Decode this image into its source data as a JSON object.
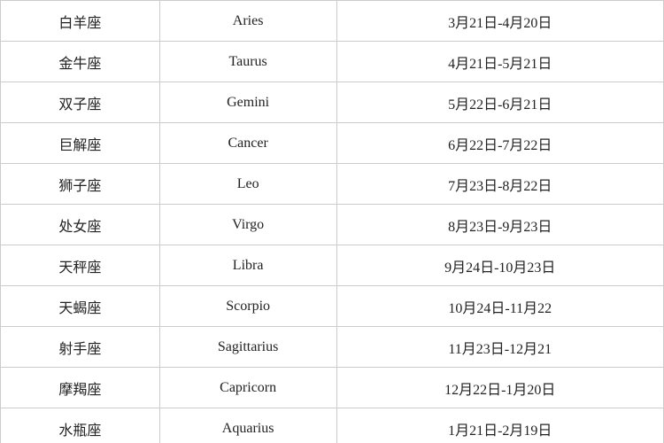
{
  "table": {
    "rows": [
      {
        "chinese": "白羊座",
        "english": "Aries",
        "dates": "3月21日-4月20日"
      },
      {
        "chinese": "金牛座",
        "english": "Taurus",
        "dates": "4月21日-5月21日"
      },
      {
        "chinese": "双子座",
        "english": "Gemini",
        "dates": "5月22日-6月21日"
      },
      {
        "chinese": "巨解座",
        "english": "Cancer",
        "dates": "6月22日-7月22日"
      },
      {
        "chinese": "狮子座",
        "english": "Leo",
        "dates": "7月23日-8月22日"
      },
      {
        "chinese": "处女座",
        "english": "Virgo",
        "dates": "8月23日-9月23日"
      },
      {
        "chinese": "天秤座",
        "english": "Libra",
        "dates": "9月24日-10月23日"
      },
      {
        "chinese": "天蝎座",
        "english": "Scorpio",
        "dates": "10月24日-11月22"
      },
      {
        "chinese": "射手座",
        "english": "Sagittarius",
        "dates": "11月23日-12月21"
      },
      {
        "chinese": "摩羯座",
        "english": "Capricorn",
        "dates": "12月22日-1月20日"
      },
      {
        "chinese": "水瓶座",
        "english": "Aquarius",
        "dates": "1月21日-2月19日"
      }
    ]
  }
}
